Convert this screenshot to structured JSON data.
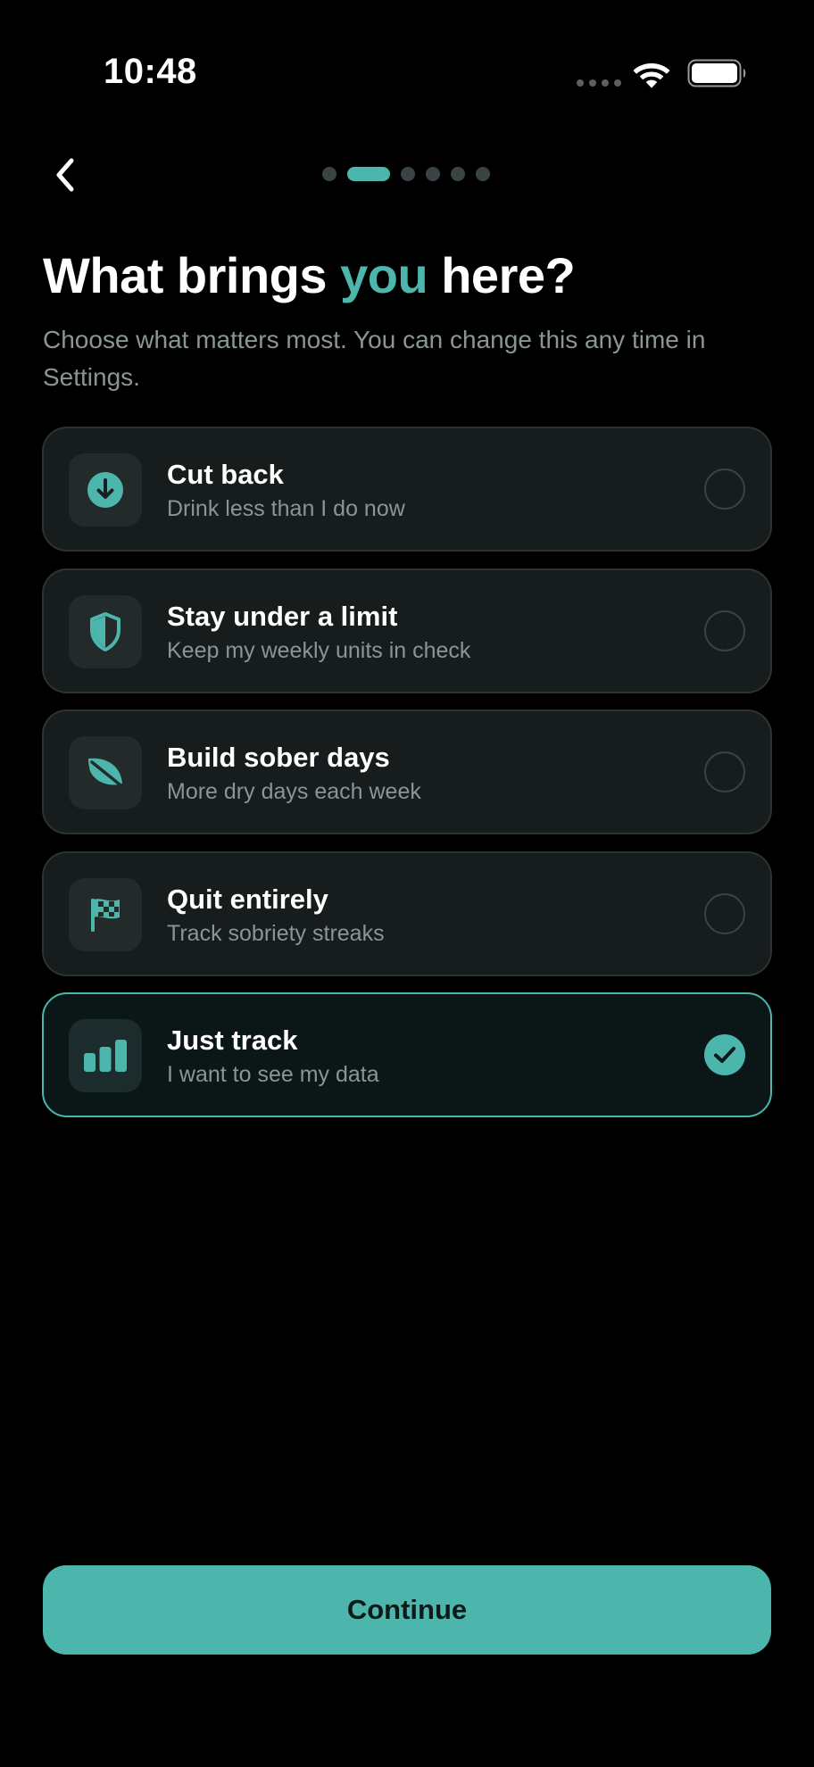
{
  "status_bar": {
    "time": "10:48"
  },
  "navigation": {
    "back_icon": "chevron-left-icon",
    "progress": {
      "total_steps": 6,
      "current_step": 2
    }
  },
  "heading": {
    "title_before": "What brings ",
    "title_accent": "you",
    "title_after": " here?",
    "subtitle": "Choose what matters most. You can change this any time in Settings."
  },
  "options": [
    {
      "icon": "arrow-down-circle-icon",
      "title": "Cut back",
      "subtitle": "Drink less than I do now",
      "selected": false
    },
    {
      "icon": "shield-icon",
      "title": "Stay under a limit",
      "subtitle": "Keep my weekly units in check",
      "selected": false
    },
    {
      "icon": "leaf-icon",
      "title": "Build sober days",
      "subtitle": "More dry days each week",
      "selected": false
    },
    {
      "icon": "checkered-flag-icon",
      "title": "Quit entirely",
      "subtitle": "Track sobriety streaks",
      "selected": false
    },
    {
      "icon": "bar-chart-icon",
      "title": "Just track",
      "subtitle": "I want to see my data",
      "selected": true
    }
  ],
  "continue_button": {
    "label": "Continue"
  },
  "colors": {
    "accent": "#4db6ac",
    "background": "#000000",
    "card": "#171c1c",
    "card_border": "#2c3333",
    "muted_text": "#8a9595"
  }
}
